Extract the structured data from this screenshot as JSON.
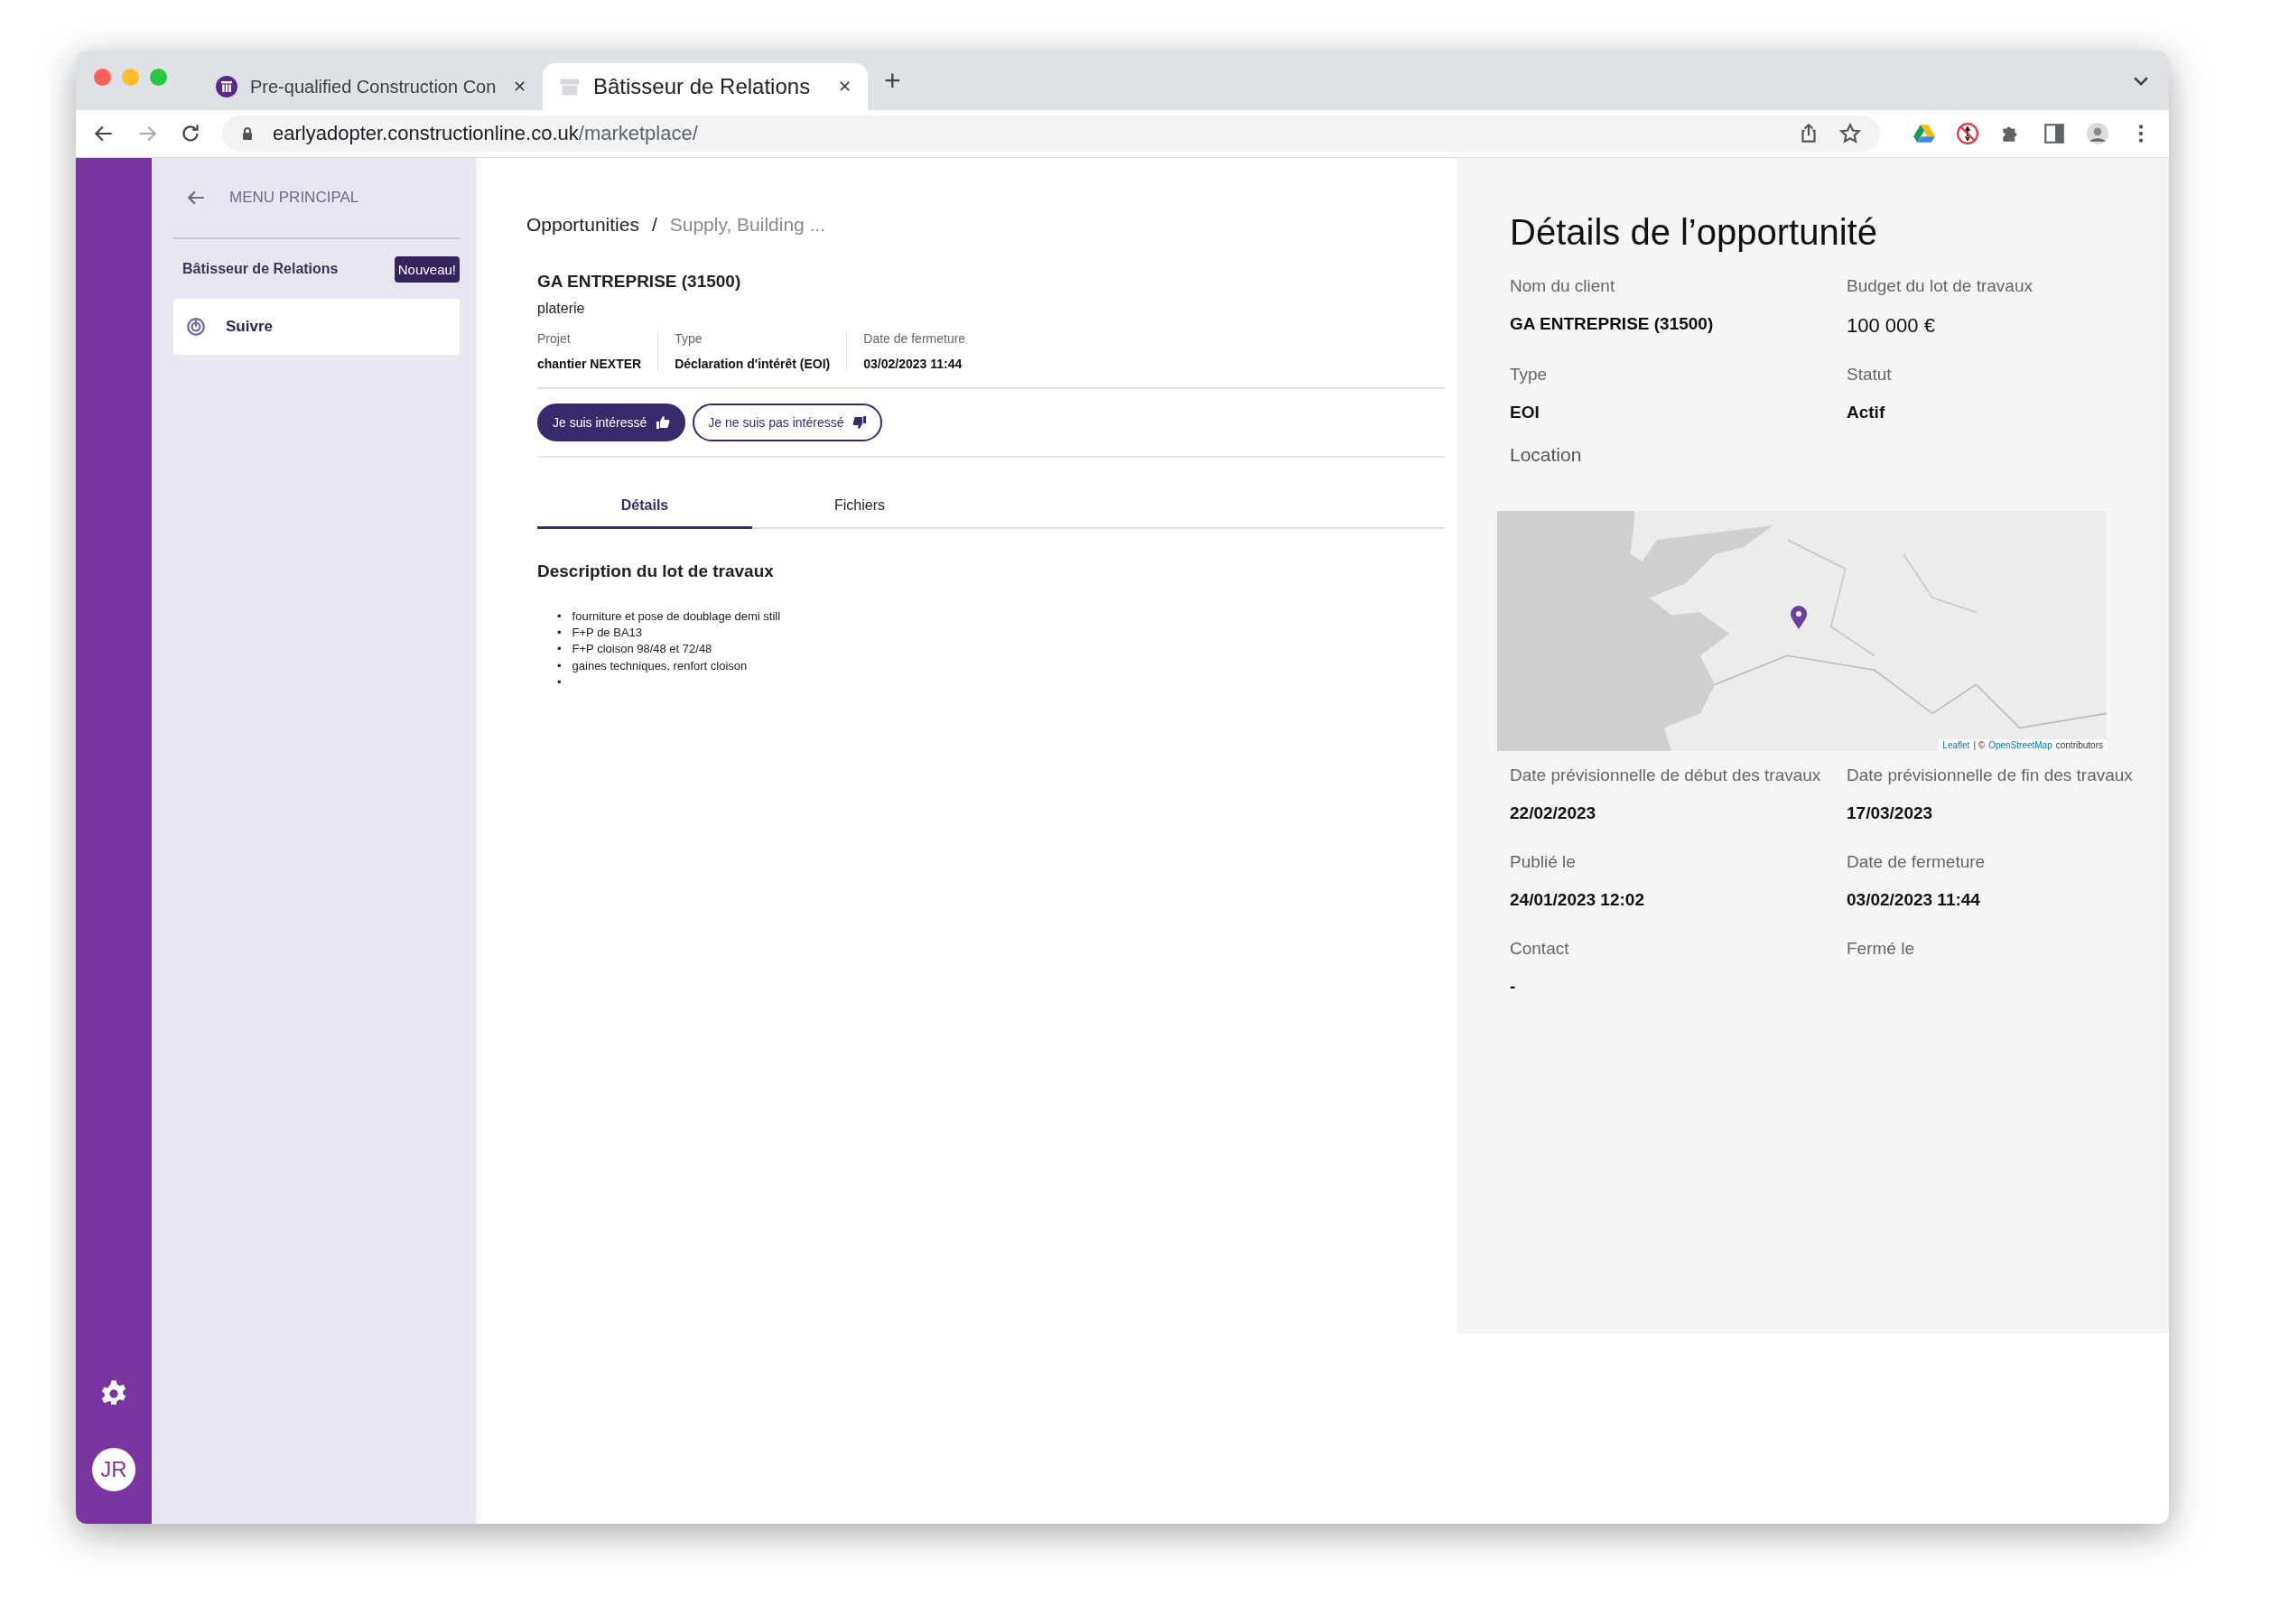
{
  "browser": {
    "tabs": [
      {
        "title": "Pre-qualified Construction Con",
        "selected": false
      },
      {
        "title": "Bâtisseur de Relations",
        "selected": true
      }
    ],
    "url_host": "earlyadopter.constructionline.co.uk",
    "url_path": "/marketplace/"
  },
  "rail": {
    "avatar": "JR"
  },
  "sidebar": {
    "back": "MENU PRINCIPAL",
    "section": "Bâtisseur de Relations",
    "badge": "Nouveau!",
    "items": [
      {
        "label": "Suivre",
        "selected": true
      }
    ]
  },
  "browser_controls": {
    "close_tab": "✕",
    "new_tab": "+"
  },
  "breadcrumb": [
    "Opportunities",
    "Supply, Building ..."
  ],
  "breadcrumb_separator": "/",
  "opportunity": {
    "client": "GA ENTREPRISE (31500)",
    "trade": "platerie",
    "meta": [
      {
        "label": "Projet",
        "value": "chantier NEXTER"
      },
      {
        "label": "Type",
        "value": "Déclaration d'intérêt (EOI)"
      },
      {
        "label": "Date de fermeture",
        "value": "03/02/2023 11:44"
      }
    ]
  },
  "actions": [
    {
      "label": "Je suis intéressé",
      "kind": "primary"
    },
    {
      "label": "Je ne suis pas intéressé",
      "kind": "outline"
    }
  ],
  "tabs": [
    {
      "label": "Détails",
      "selected": true
    },
    {
      "label": "Fichiers",
      "selected": false
    }
  ],
  "description": {
    "heading": "Description du lot de travaux",
    "items": [
      "fourniture et pose de doublage demi still",
      "F+P de BA13",
      "F+P cloison 98/48 et 72/48",
      "gaines techniques, renfort cloison"
    ],
    "trailing_blank_item": true,
    "bullet": "•"
  },
  "details": {
    "title": "Détails de l’opportunité",
    "fields_top": [
      {
        "label": "Nom du client",
        "value": "GA ENTREPRISE (31500)",
        "kind": "text"
      },
      {
        "label": "Budget du lot de travaux",
        "value": "100 000 €",
        "kind": "amount"
      },
      {
        "label": "Type",
        "value": "EOI",
        "kind": "text"
      },
      {
        "label": "Statut",
        "value": "Actif",
        "kind": "text"
      }
    ],
    "location_label": "Location",
    "map_attribution": [
      {
        "text": "Leaflet",
        "link": true
      },
      {
        "text": "| ©",
        "link": false
      },
      {
        "text": "OpenStreetMap",
        "link": true
      },
      {
        "text": "contributors",
        "link": false
      }
    ],
    "fields_bottom": [
      {
        "label": "Date prévisionnelle de début des travaux",
        "value": "22/02/2023"
      },
      {
        "label": "Date prévisionnelle de fin des travaux",
        "value": "17/03/2023"
      },
      {
        "label": "Publié le",
        "value": "24/01/2023 12:02"
      },
      {
        "label": "Date de fermeture",
        "value": "03/02/2023 11:44"
      },
      {
        "label": "Contact",
        "value": "-"
      },
      {
        "label": "Fermé le"
      }
    ]
  }
}
